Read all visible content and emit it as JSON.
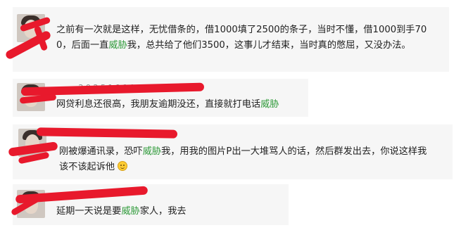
{
  "comments": [
    {
      "line1_a": "之前有一次就是这样，无忧借条的，借1000填了2500的条子，当时不懂，借1000到手70",
      "line2_a": "0，后面一直",
      "keyword": "威胁",
      "line2_b": "我，总共给了他们3500，这事儿才结束，当时真的憋屈，又没办法。"
    },
    {
      "username": "········ 2 9 2 5 1 9 1 1",
      "line1_a": "网贷利息还很高，我朋友逾期没还，直接就打电话",
      "keyword": "威胁"
    },
    {
      "username": "····· ··· · ··",
      "line1_a": "刚被爆通讯录，恐吓",
      "keyword": "威胁",
      "line1_b": "我，用我的图片P出一大堆骂人的话，然后群发出去，你说这样我",
      "line2_a": "该不该起诉他"
    },
    {
      "username": "·· ··· ·· ·· ·",
      "line1_a": "延期一天说是要",
      "keyword": "威胁",
      "line1_b": "家人，我去"
    }
  ],
  "colors": {
    "keyword": "#2f9a3a",
    "redaction": "#e8192c",
    "card_bg": "#f6f6f6"
  },
  "icons": [
    "avatar",
    "smile-emoji-icon"
  ]
}
